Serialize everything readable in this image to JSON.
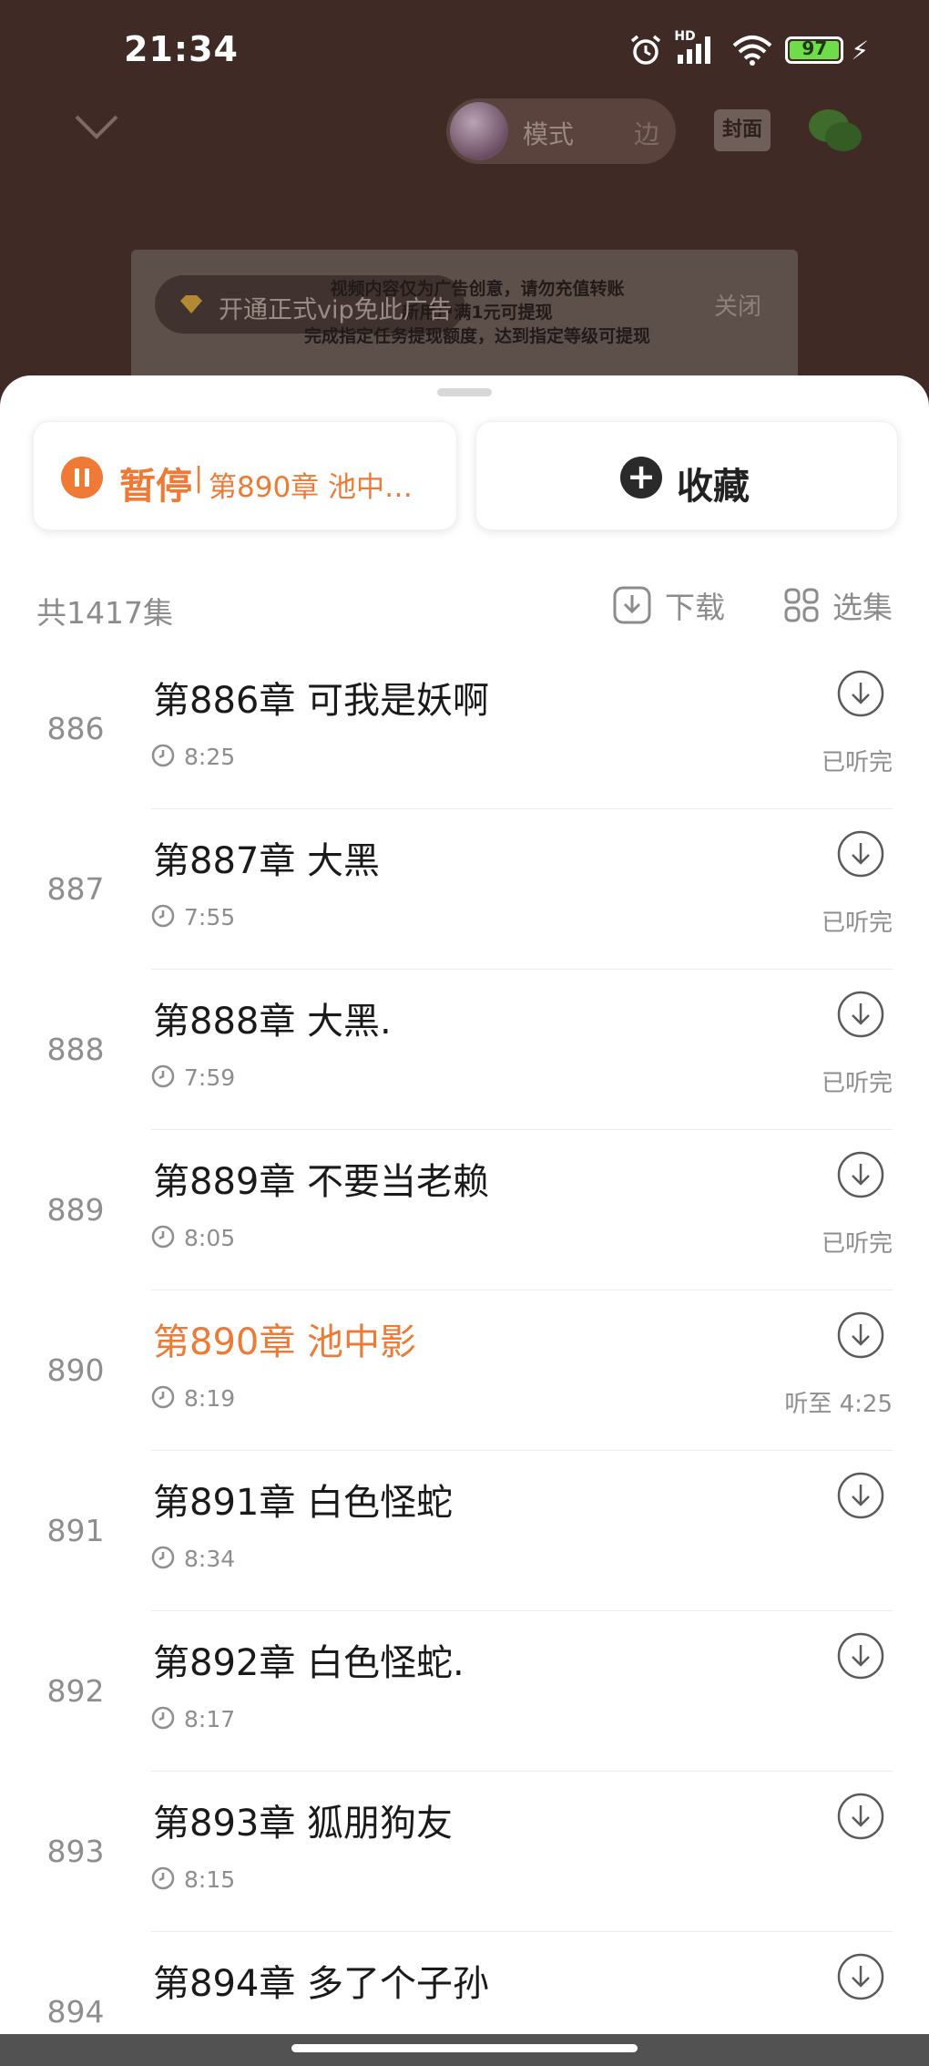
{
  "status_bar": {
    "time": "21:34",
    "network_badge": "HD",
    "battery_level": "97",
    "icons": [
      "alarm-icon",
      "signal-icon",
      "wifi-icon",
      "battery-icon",
      "charging-icon"
    ]
  },
  "player_header": {
    "mode_label": "模式",
    "mode_label_trailing": "边",
    "cover_label": "封面"
  },
  "ad_banner": {
    "vip_label": "开通正式vip免此广告",
    "close_label": "关闭",
    "notice_lines": [
      "视频内容仅为广告创意，请勿充值转账",
      "新用户满1元可提现",
      "完成指定任务提现额度，达到指定等级可提现"
    ]
  },
  "sheet": {
    "pause_card": {
      "label": "暂停",
      "separator": "|",
      "chapter": "第890章 池中…"
    },
    "favorite_card": {
      "label": "收藏"
    },
    "total_count": "共1417集",
    "download_label": "下载",
    "select_label": "选集",
    "chapters": [
      {
        "number": "886",
        "title": "第886章 可我是妖啊",
        "duration": "8:25",
        "status": "已听完"
      },
      {
        "number": "887",
        "title": "第887章 大黑",
        "duration": "7:55",
        "status": "已听完"
      },
      {
        "number": "888",
        "title": "第888章 大黑.",
        "duration": "7:59",
        "status": "已听完"
      },
      {
        "number": "889",
        "title": "第889章 不要当老赖",
        "duration": "8:05",
        "status": "已听完"
      },
      {
        "number": "890",
        "title": "第890章 池中影",
        "duration": "8:19",
        "status": "听至 4:25"
      },
      {
        "number": "891",
        "title": "第891章 白色怪蛇",
        "duration": "8:34",
        "status": ""
      },
      {
        "number": "892",
        "title": "第892章 白色怪蛇.",
        "duration": "8:17",
        "status": ""
      },
      {
        "number": "893",
        "title": "第893章 狐朋狗友",
        "duration": "8:15",
        "status": ""
      },
      {
        "number": "894",
        "title": "第894章 多了个子孙",
        "duration": "",
        "status": ""
      }
    ]
  },
  "colors": {
    "accent": "#ef7a35",
    "text_primary": "#1a1a1a",
    "text_secondary": "#8e8e8e",
    "backdrop": "#3f2a25"
  }
}
